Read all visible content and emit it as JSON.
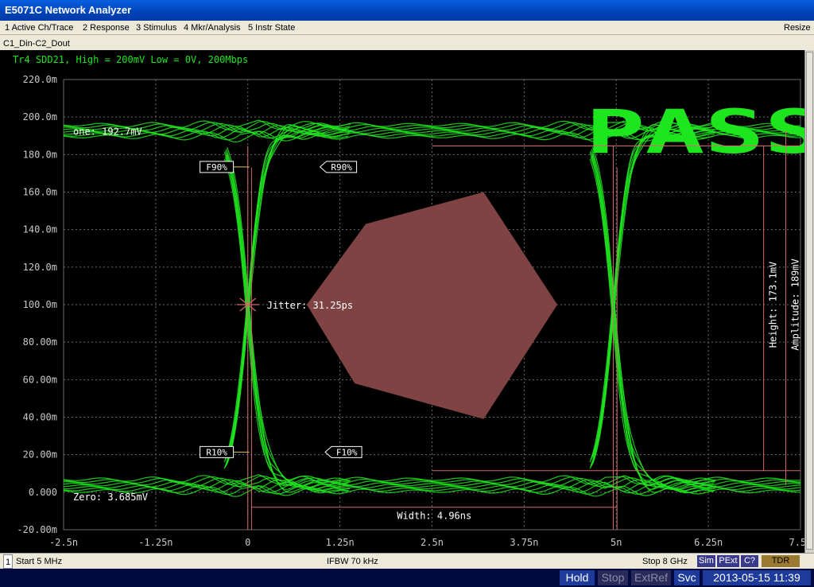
{
  "window": {
    "title": "E5071C Network Analyzer"
  },
  "menu": {
    "items": [
      "1 Active Ch/Trace",
      "2 Response",
      "3 Stimulus",
      "4 Mkr/Analysis",
      "5 Instr State"
    ],
    "resize": "Resize"
  },
  "channel": {
    "tab_label": "C1_Din-C2_Dout"
  },
  "trace": {
    "header": "Tr4 SDD21, High = 200mV Low = 0V, 200Mbps"
  },
  "colors": {
    "trace": "#1ee61e",
    "mask": "#7f4343",
    "grid": "#6a6a6a",
    "marker_line": "#d46a6a"
  },
  "chart_data": {
    "type": "line",
    "subtype": "eye-diagram",
    "xlabel": "",
    "ylabel": "",
    "x_ticks": [
      "-2.5n",
      "-1.25n",
      "0",
      "1.25n",
      "2.5n",
      "3.75n",
      "5n",
      "6.25n",
      "7.5n"
    ],
    "x_tick_values": [
      -2.5,
      -1.25,
      0,
      1.25,
      2.5,
      3.75,
      5,
      6.25,
      7.5
    ],
    "xlim": [
      -2.5,
      7.5
    ],
    "y_ticks": [
      "220.0m",
      "200.0m",
      "180.0m",
      "160.0m",
      "140.0m",
      "120.0m",
      "100.0m",
      "80.00m",
      "60.00m",
      "40.00m",
      "20.00m",
      "0.000",
      "-20.00m"
    ],
    "y_tick_values": [
      220,
      200,
      180,
      160,
      140,
      120,
      100,
      80,
      60,
      40,
      20,
      0,
      -20
    ],
    "ylim": [
      -20,
      220
    ],
    "grid": true,
    "one_level": {
      "label": "one: 192.7mV",
      "value": 192.7
    },
    "zero_level": {
      "label": "Zero: 3.685mV",
      "value": 3.685
    },
    "crossings_ns": [
      0,
      4.96
    ],
    "jitter": {
      "label": "Jitter: 31.25ps",
      "x": 0,
      "y": 100
    },
    "width": {
      "label": "Width: 4.96ns",
      "x_start": 0.05,
      "x_end": 5.01,
      "y": -8
    },
    "height": {
      "label": "Height: 173.1mV",
      "low": 11.5,
      "high": 184.6,
      "x": 7.0
    },
    "amplitude": {
      "label": "Amplitude: 189mV",
      "low": 3.685,
      "high": 192.7,
      "x": 7.3
    },
    "markers": [
      {
        "label": "F90%",
        "x": 0.02,
        "y": 173.4,
        "side": "left"
      },
      {
        "label": "R90%",
        "x": 0.98,
        "y": 173.4,
        "side": "right"
      },
      {
        "label": "R10%",
        "x": 0.02,
        "y": 21.4,
        "side": "left"
      },
      {
        "label": "F10%",
        "x": 1.05,
        "y": 21.4,
        "side": "right"
      }
    ],
    "mask_polygon": [
      [
        0.8,
        100
      ],
      [
        1.6,
        143
      ],
      [
        3.2,
        160
      ],
      [
        4.2,
        100
      ],
      [
        3.2,
        39
      ],
      [
        1.45,
        58
      ]
    ],
    "pass_label": "PASS"
  },
  "status": {
    "start": "Start 5 MHz",
    "ifbw": "IFBW 70 kHz",
    "stop": "Stop 8 GHz",
    "channel_num": "1",
    "buttons": [
      "Sim",
      "PExt",
      "C?",
      "TDR"
    ]
  },
  "bottom": {
    "hold": "Hold",
    "stop": "Stop",
    "extref": "ExtRef",
    "svc": "Svc",
    "datetime": "2013-05-15 11:39"
  }
}
